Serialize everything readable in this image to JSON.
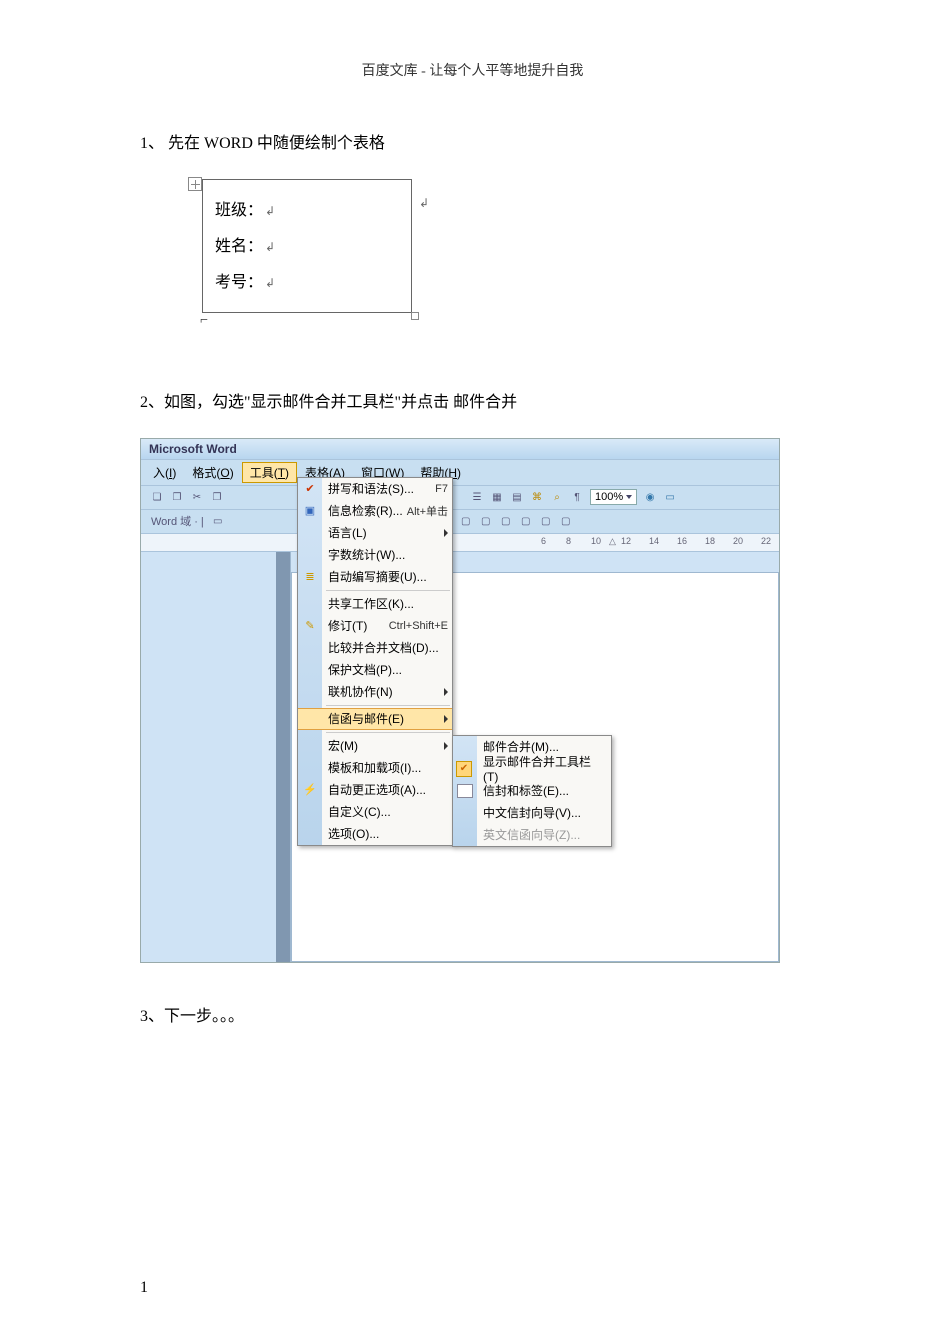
{
  "header": "百度文库 - 让每个人平等地提升自我",
  "step1": {
    "num": "1",
    "text_before": "、 先在 ",
    "word": "WORD",
    "text_after": " 中随便绘制个表格",
    "rows": [
      "班级：",
      "姓名：",
      "考号："
    ]
  },
  "step2": {
    "num": "2",
    "text": "、如图，勾选\"显示邮件合并工具栏\"并点击  邮件合并"
  },
  "step3": {
    "num": "3",
    "text": "、下一步。。。"
  },
  "word_app": {
    "title": "Microsoft Word",
    "menubar": [
      {
        "pre": "入(",
        "key": "I",
        "post": ")"
      },
      {
        "pre": "格式(",
        "key": "O",
        "post": ")"
      },
      {
        "pre": "工具(",
        "key": "T",
        "post": ")",
        "pressed": true
      },
      {
        "pre": "表格(",
        "key": "A",
        "post": ")"
      },
      {
        "pre": "窗口(",
        "key": "W",
        "post": ")"
      },
      {
        "pre": "帮助(",
        "key": "H",
        "post": ")"
      }
    ],
    "toolbar1_text": "Word 域 · | ",
    "zoom": "100%",
    "ruler_numbers": [
      "6",
      "8",
      "10",
      "12",
      "14",
      "16",
      "18",
      "20",
      "22"
    ],
    "dropdown": [
      {
        "label": "拼写和语法(S)...",
        "shortcut": "F7",
        "icon": "abc"
      },
      {
        "label": "信息检索(R)...",
        "shortcut": "Alt+单击",
        "icon": "book"
      },
      {
        "label": "语言(L)",
        "arrow": true
      },
      {
        "label": "字数统计(W)..."
      },
      {
        "label": "自动编写摘要(U)...",
        "icon": "sum"
      },
      {
        "sep": true
      },
      {
        "label": "共享工作区(K)..."
      },
      {
        "label": "修订(T)",
        "shortcut": "Ctrl+Shift+E",
        "icon": "track"
      },
      {
        "label": "比较并合并文档(D)..."
      },
      {
        "label": "保护文档(P)..."
      },
      {
        "label": "联机协作(N)",
        "arrow": true
      },
      {
        "sep": true
      },
      {
        "label": "信函与邮件(E)",
        "arrow": true,
        "highlight": true
      },
      {
        "sep": true
      },
      {
        "label": "宏(M)",
        "arrow": true
      },
      {
        "label": "模板和加载项(I)..."
      },
      {
        "label": "自动更正选项(A)...",
        "icon": "auto"
      },
      {
        "label": "自定义(C)..."
      },
      {
        "label": "选项(O)..."
      }
    ],
    "submenu": [
      {
        "label": "邮件合并(M)..."
      },
      {
        "label": "显示邮件合并工具栏(T)",
        "checked": true
      },
      {
        "label": "信封和标签(E)...",
        "icon": true
      },
      {
        "label": "中文信封向导(V)..."
      },
      {
        "label": "英文信函向导(Z)...",
        "disabled": true
      }
    ]
  },
  "page_number": "1"
}
